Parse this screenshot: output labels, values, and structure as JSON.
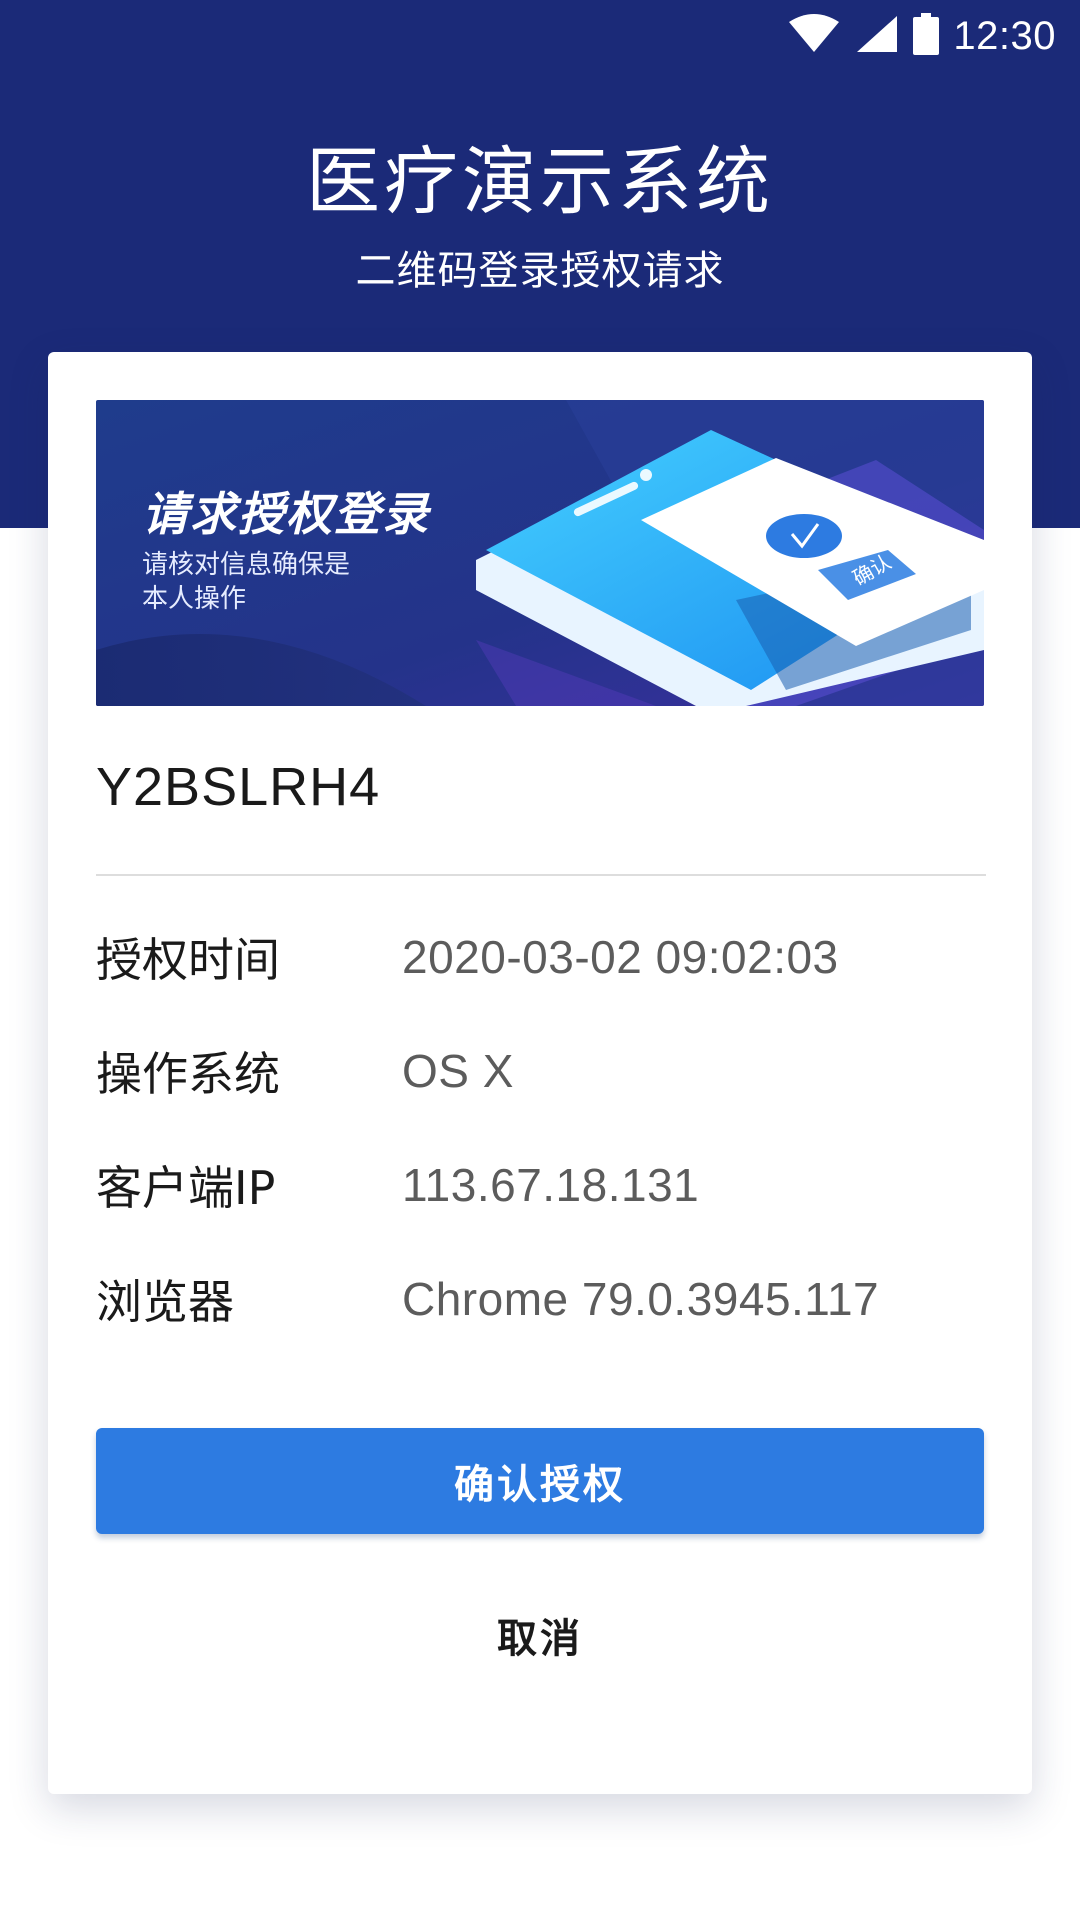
{
  "status_bar": {
    "time": "12:30",
    "icons": [
      "wifi-icon",
      "signal-icon",
      "battery-icon"
    ]
  },
  "header": {
    "title": "医疗演示系统",
    "subtitle": "二维码登录授权请求"
  },
  "banner": {
    "title": "请求授权登录",
    "text_line1": "请核对信息确保是",
    "text_line2": "本人操作",
    "phone_badge": "确认"
  },
  "auth": {
    "code": "Y2BSLRH4",
    "rows": [
      {
        "label": "授权时间",
        "value": "2020-03-02 09:02:03"
      },
      {
        "label": "操作系统",
        "value": "OS X"
      },
      {
        "label": "客户端IP",
        "value": "113.67.18.131"
      },
      {
        "label": "浏览器",
        "value": "Chrome 79.0.3945.117"
      }
    ]
  },
  "actions": {
    "confirm_label": "确认授权",
    "cancel_label": "取消"
  },
  "colors": {
    "header_bg": "#1b2a78",
    "primary_button": "#2d7be1",
    "card_bg": "#ffffff"
  }
}
